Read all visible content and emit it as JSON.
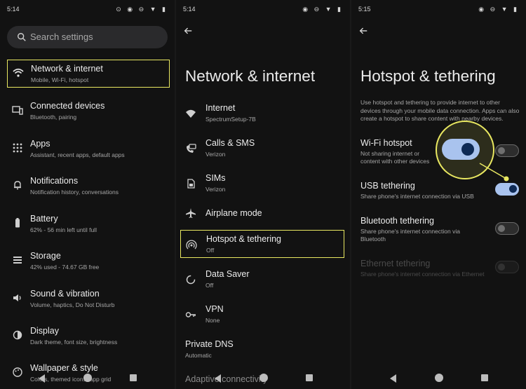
{
  "panel1": {
    "time": "5:14",
    "search_placeholder": "Search settings",
    "items": [
      {
        "title": "Network & internet",
        "subtitle": "Mobile, Wi-Fi, hotspot",
        "icon": "wifi-icon"
      },
      {
        "title": "Connected devices",
        "subtitle": "Bluetooth, pairing",
        "icon": "devices-icon"
      },
      {
        "title": "Apps",
        "subtitle": "Assistant, recent apps, default apps",
        "icon": "apps-grid-icon"
      },
      {
        "title": "Notifications",
        "subtitle": "Notification history, conversations",
        "icon": "bell-icon"
      },
      {
        "title": "Battery",
        "subtitle": "62% - 56 min left until full",
        "icon": "battery-icon"
      },
      {
        "title": "Storage",
        "subtitle": "42% used - 74.67 GB free",
        "icon": "storage-icon"
      },
      {
        "title": "Sound & vibration",
        "subtitle": "Volume, haptics, Do Not Disturb",
        "icon": "volume-icon"
      },
      {
        "title": "Display",
        "subtitle": "Dark theme, font size, brightness",
        "icon": "display-icon"
      },
      {
        "title": "Wallpaper & style",
        "subtitle": "Colors, themed icons, app grid",
        "icon": "palette-icon"
      }
    ]
  },
  "panel2": {
    "time": "5:14",
    "title": "Network & internet",
    "items": [
      {
        "title": "Internet",
        "subtitle": "SpectrumSetup-7B",
        "icon": "wifi-icon"
      },
      {
        "title": "Calls & SMS",
        "subtitle": "Verizon",
        "icon": "calls-sms-icon"
      },
      {
        "title": "SIMs",
        "subtitle": "Verizon",
        "icon": "sim-icon"
      },
      {
        "title": "Airplane mode",
        "subtitle": "",
        "icon": "airplane-icon"
      },
      {
        "title": "Hotspot & tethering",
        "subtitle": "Off",
        "icon": "hotspot-icon"
      },
      {
        "title": "Data Saver",
        "subtitle": "Off",
        "icon": "data-saver-icon"
      },
      {
        "title": "VPN",
        "subtitle": "None",
        "icon": "vpn-key-icon"
      },
      {
        "title": "Private DNS",
        "subtitle": "Automatic",
        "icon": ""
      },
      {
        "title": "Adaptive connectivity",
        "subtitle": "",
        "icon": ""
      }
    ],
    "airplane_mode_on": false
  },
  "panel3": {
    "time": "5:15",
    "title": "Hotspot & tethering",
    "description": "Use hotspot and tethering to provide internet to other devices through your mobile data connection. Apps can also create a hotspot to share content with nearby devices.",
    "items": [
      {
        "title": "Wi-Fi hotspot",
        "subtitle": "Not sharing internet or content with other devices",
        "on": false,
        "enabled": true
      },
      {
        "title": "USB tethering",
        "subtitle": "Share phone's internet connection via USB",
        "on": true,
        "enabled": true
      },
      {
        "title": "Bluetooth tethering",
        "subtitle": "Share phone's internet connection via Bluetooth",
        "on": false,
        "enabled": true
      },
      {
        "title": "Ethernet tethering",
        "subtitle": "Share phone's internet connection via Ethernet",
        "on": false,
        "enabled": false
      }
    ]
  },
  "colors": {
    "background": "#121212",
    "highlight": "#e9e861",
    "toggle_on": "#a9c3ee",
    "toggle_knob_on": "#0e2a55"
  }
}
